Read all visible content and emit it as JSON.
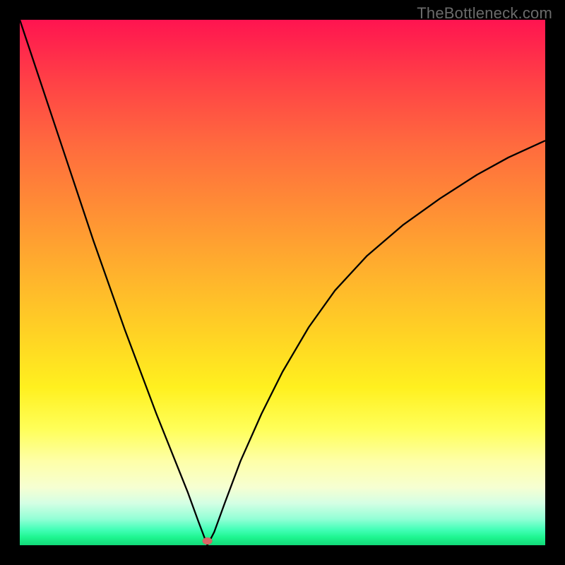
{
  "watermark": "TheBottleneck.com",
  "chart_data": {
    "type": "line",
    "title": "",
    "xlabel": "",
    "ylabel": "",
    "xlim": [
      0,
      100
    ],
    "ylim": [
      0,
      100
    ],
    "grid": false,
    "series": [
      {
        "name": "curve",
        "x": [
          0,
          2,
          5,
          8,
          11,
          14,
          17,
          20,
          23,
          26,
          29,
          32,
          34,
          35.7,
          37,
          39,
          42,
          46,
          50,
          55,
          60,
          66,
          73,
          80,
          87,
          93,
          100
        ],
        "values": [
          100,
          94,
          85,
          76,
          67,
          58,
          49.5,
          41,
          33,
          25,
          17.5,
          10,
          4.5,
          0,
          2.5,
          8,
          16,
          25,
          33,
          41.5,
          48.5,
          55,
          61,
          66,
          70.5,
          73.8,
          77
        ]
      }
    ],
    "markers": [
      {
        "name": "minimum",
        "x": 35.7,
        "y": 0.8
      }
    ],
    "colors": {
      "curve": "#000000",
      "marker": "#d86666"
    }
  }
}
